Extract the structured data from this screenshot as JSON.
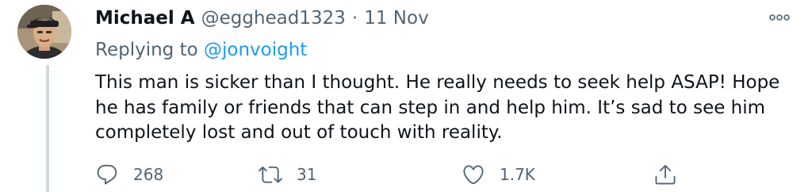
{
  "tweet": {
    "display_name": "Michael A",
    "handle": "@egghead1323",
    "separator": "·",
    "date": "11 Nov",
    "replying_prefix": "Replying to ",
    "replying_to": "@jonvoight",
    "lines": [
      "This man is sicker than I thought. He really needs to seek help ASAP! Hope",
      "he has family or friends that can step in and help him. It’s sad to see him",
      "completely lost and out of touch with reality."
    ],
    "actions": {
      "reply_count": "268",
      "retweet_count": "31",
      "like_count": "1.7K"
    }
  },
  "icons": {
    "more": "more-horizontal-icon",
    "reply": "speech-bubble-icon",
    "retweet": "retweet-arrows-icon",
    "like": "heart-icon",
    "share": "share-upload-icon"
  },
  "colors": {
    "text": "#0f1419",
    "secondary": "#536471",
    "link": "#1d9bf0",
    "thread_line": "#cfd9de"
  }
}
